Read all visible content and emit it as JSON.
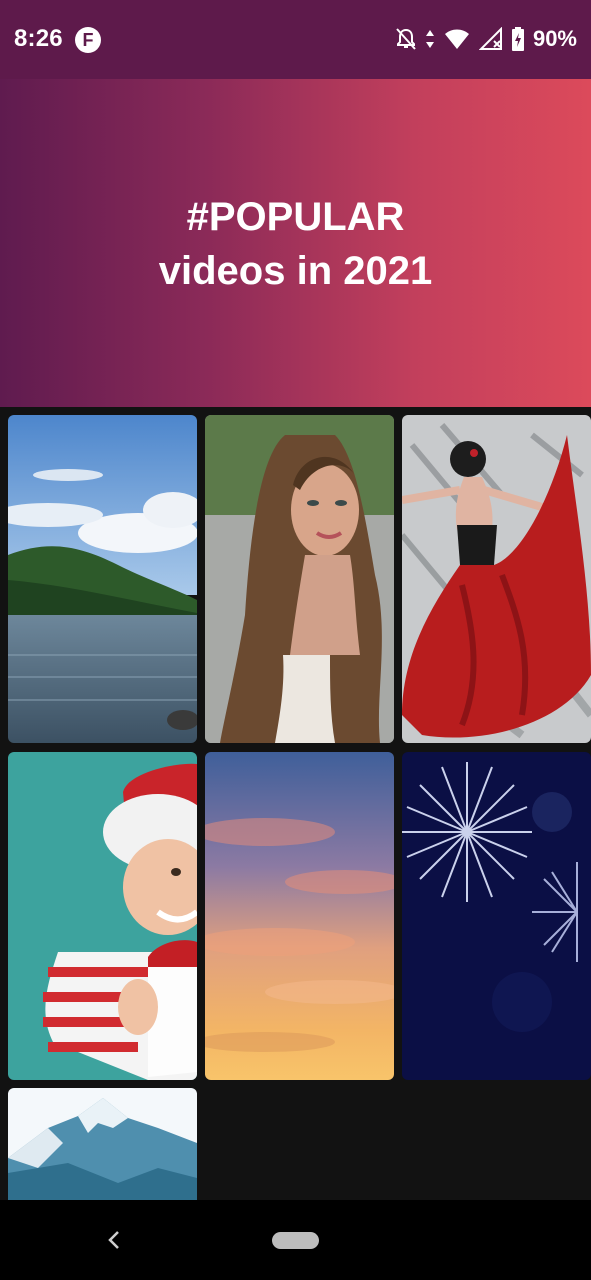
{
  "status_bar": {
    "time": "8:26",
    "app_badge": "F",
    "battery_percent": "90%",
    "icons": [
      "notifications-off-icon",
      "data-arrows-icon",
      "wifi-icon",
      "cell-signal-icon",
      "battery-icon"
    ]
  },
  "hero": {
    "line1": "#POPULAR",
    "line2": "videos in 2021"
  },
  "grid": {
    "tiles": [
      {
        "name": "river-landscape-thumbnail",
        "subject": "river with forested hills"
      },
      {
        "name": "woman-portrait-thumbnail",
        "subject": "long-haired woman smiling"
      },
      {
        "name": "dancer-painting-thumbnail",
        "subject": "painting of dancer in red dress"
      },
      {
        "name": "santa-hat-boy-thumbnail",
        "subject": "boy in santa hat with gift"
      },
      {
        "name": "sunset-sky-thumbnail",
        "subject": "sunset sky with clouds"
      },
      {
        "name": "fireworks-thumbnail",
        "subject": "fireworks in night sky"
      },
      {
        "name": "snowy-mountain-thumbnail",
        "subject": "snowy mountain peak"
      }
    ]
  },
  "nav_bar": {
    "icons": [
      "back-icon",
      "home-pill"
    ]
  },
  "colors": {
    "status_bar": "#5e1a4b",
    "hero_start": "#5f1b4f",
    "hero_end": "#dc4a5b",
    "background": "#121212"
  }
}
